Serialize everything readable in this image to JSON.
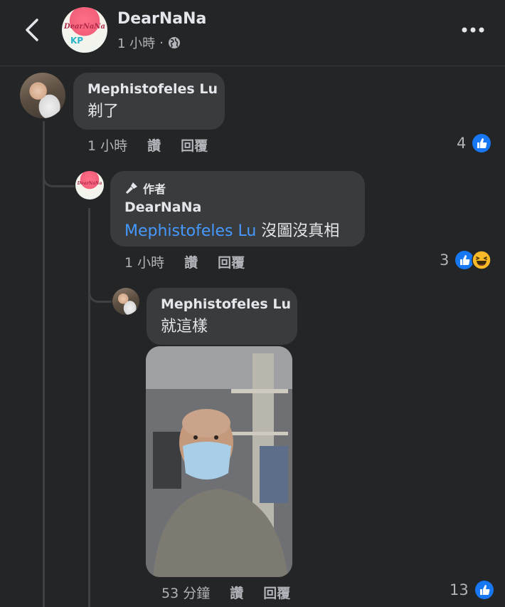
{
  "header": {
    "page_name": "DearNaNa",
    "post_time": "1 小時",
    "separator": "·",
    "logo_text": "DearNaNa",
    "logo_subtext": "KP"
  },
  "comments": [
    {
      "author": "Mephistofeles Lu",
      "text": "剃了",
      "time": "1 小時",
      "like_label": "讚",
      "reply_label": "回覆",
      "reaction_count": "4"
    },
    {
      "badge": "作者",
      "author": "DearNaNa",
      "mention": "Mephistofeles Lu",
      "text": " 沒圖沒真相",
      "time": "1 小時",
      "like_label": "讚",
      "reply_label": "回覆",
      "reaction_count": "3"
    },
    {
      "author": "Mephistofeles Lu",
      "text": "就這樣",
      "time": "53 分鐘",
      "like_label": "讚",
      "reply_label": "回覆",
      "reaction_count": "13"
    }
  ],
  "colors": {
    "background": "#242526",
    "bubble": "#3a3b3c",
    "mention": "#4599ff",
    "like_blue": "#1877f2",
    "haha_yellow": "#f7b928"
  }
}
